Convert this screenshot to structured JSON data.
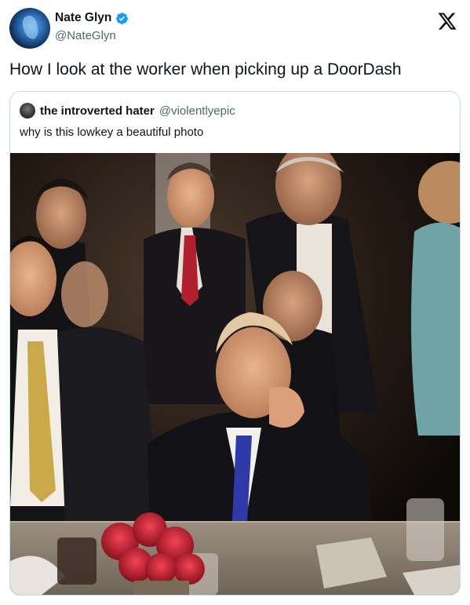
{
  "author": {
    "display_name": "Nate Glyn",
    "handle": "@NateGlyn",
    "verified": true,
    "avatar_icon": "avatar-icon"
  },
  "platform_logo": "x-logo-icon",
  "tweet": {
    "text": "How I look at the worker when picking up a DoorDash"
  },
  "quoted_tweet": {
    "display_name": "the introverted hater",
    "handle": "@violentlyepic",
    "text": "why is this lowkey a beautiful photo",
    "media_icon": "photo-image"
  },
  "colors": {
    "text": "#0f1419",
    "secondary": "#536471",
    "verified": "#1d9bf0",
    "border": "#cfd9de"
  }
}
